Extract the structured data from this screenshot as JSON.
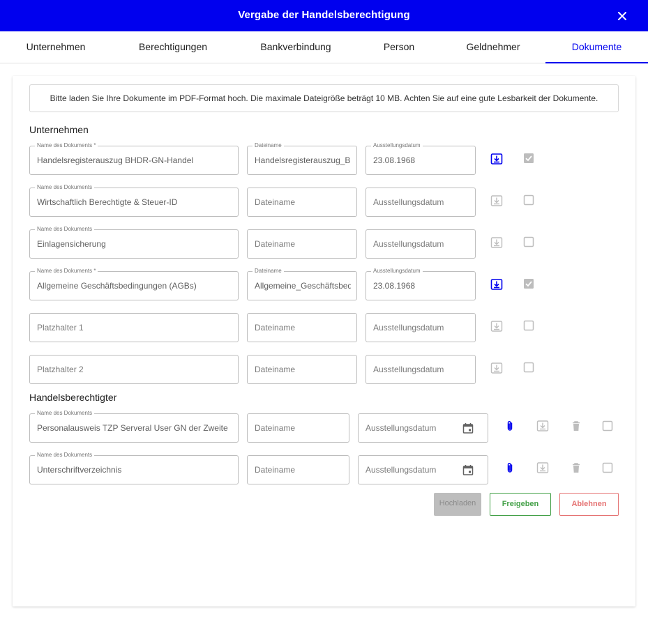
{
  "dialog": {
    "title": "Vergabe der Handelsberechtigung"
  },
  "tabs": [
    {
      "label": "Unternehmen"
    },
    {
      "label": "Berechtigungen"
    },
    {
      "label": "Bankverbindung"
    },
    {
      "label": "Person"
    },
    {
      "label": "Geldnehmer"
    },
    {
      "label": "Dokumente",
      "active": true
    }
  ],
  "notice": "Bitte laden Sie Ihre Dokumente im PDF-Format hoch. Die maximale Dateigröße beträgt 10 MB. Achten Sie auf eine gute Lesbarkeit der Dokumente.",
  "sections": {
    "company": "Unternehmen",
    "trader": "Handelsberechtigter"
  },
  "company_rows": [
    {
      "name_label": "Name des Dokuments *",
      "name": "Handelsregisterauszug BHDR-GN-Handel",
      "file_label": "Dateiname",
      "file": "Handelsregisterauszug_B",
      "date_label": "Ausstellungsdatum",
      "date": "23.08.1968",
      "download_enabled": true,
      "checked": true
    },
    {
      "name_label": "Name des Dokuments",
      "name": "Wirtschaftlich Berechtigte & Steuer-ID",
      "file_placeholder": "Dateiname",
      "date_placeholder": "Ausstellungsdatum",
      "download_enabled": false,
      "checked": false
    },
    {
      "name_label": "Name des Dokuments",
      "name": "Einlagensicherung",
      "file_placeholder": "Dateiname",
      "date_placeholder": "Ausstellungsdatum",
      "download_enabled": false,
      "checked": false
    },
    {
      "name_label": "Name des Dokuments *",
      "name": "Allgemeine Geschäftsbedingungen (AGBs)",
      "file_label": "Dateiname",
      "file": "Allgemeine_Geschäftsbed",
      "date_label": "Ausstellungsdatum",
      "date": "23.08.1968",
      "download_enabled": true,
      "checked": true
    },
    {
      "name_placeholder": "Platzhalter 1",
      "file_placeholder": "Dateiname",
      "date_placeholder": "Ausstellungsdatum",
      "download_enabled": false,
      "checked": false
    },
    {
      "name_placeholder": "Platzhalter 2",
      "file_placeholder": "Dateiname",
      "date_placeholder": "Ausstellungsdatum",
      "download_enabled": false,
      "checked": false
    }
  ],
  "trader_rows": [
    {
      "name_label": "Name des Dokuments",
      "name": "Personalausweis TZP Serveral User GN der Zweite",
      "file_placeholder": "Dateiname",
      "date_placeholder": "Ausstellungsdatum",
      "checked": false
    },
    {
      "name_label": "Name des Dokuments",
      "name": "Unterschriftverzeichnis",
      "file_placeholder": "Dateiname",
      "date_placeholder": "Ausstellungsdatum",
      "checked": false
    }
  ],
  "buttons": {
    "upload": "Hochladen",
    "approve": "Freigeben",
    "reject": "Ablehnen"
  },
  "colors": {
    "primary": "#0000ee",
    "approve": "#43a047",
    "reject": "#e57373",
    "disabled_bg": "#bdbdbd"
  },
  "icons": [
    "close-icon",
    "download-icon",
    "checkbox-icon",
    "calendar-icon",
    "paperclip-icon",
    "trash-icon"
  ]
}
